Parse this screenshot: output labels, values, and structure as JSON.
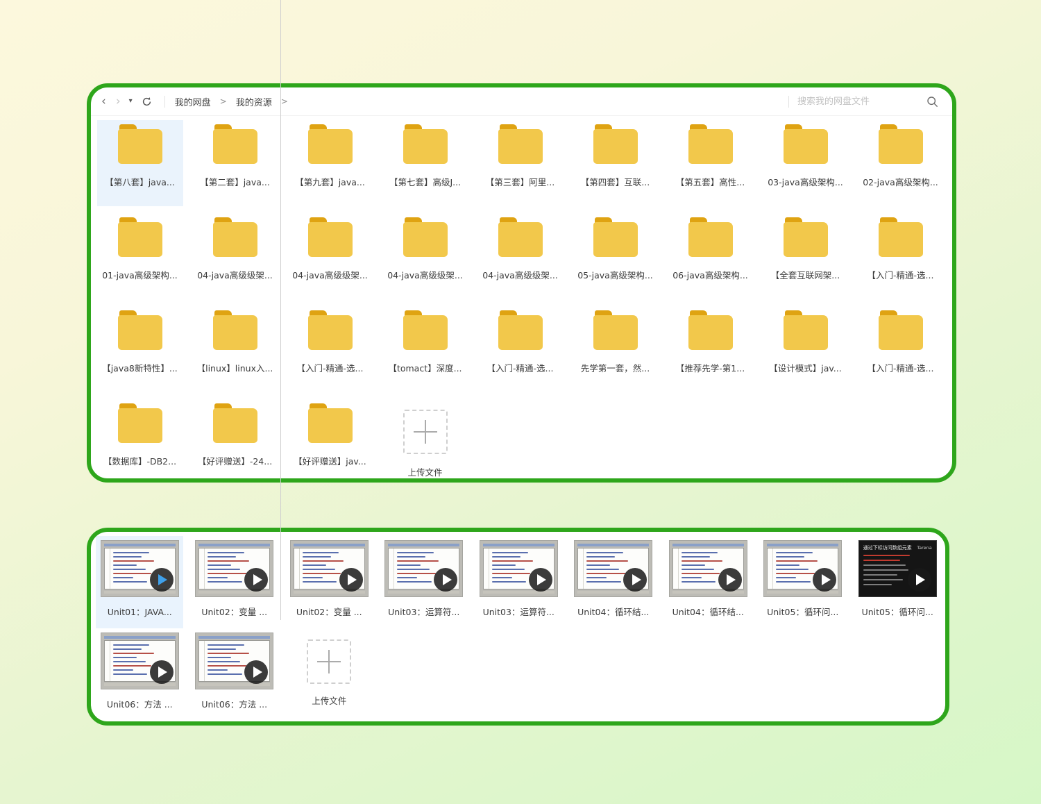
{
  "colors": {
    "panel_border": "#2ea61b",
    "selected_bg": "#eaf3fc",
    "folder_body": "#f2c84b",
    "folder_tab": "#dfa312",
    "background_top": "#fcf8dd",
    "background_bottom": "#d6f7c7",
    "play_blue": "#3fa0ea"
  },
  "toolbar": {
    "back_icon": "‹",
    "forward_icon": "›",
    "dropdown_icon": "▾",
    "breadcrumb": [
      {
        "label": "我的网盘"
      },
      {
        "label": "我的资源"
      }
    ],
    "breadcrumb_separator": ">",
    "search_placeholder": "搜索我的网盘文件"
  },
  "folders": {
    "selected_index": 0,
    "upload_label": "上传文件",
    "items": [
      "【第八套】java...",
      "【第二套】java...",
      "【第九套】java...",
      "【第七套】高级J...",
      "【第三套】阿里...",
      "【第四套】互联...",
      "【第五套】高性...",
      "03-java高级架构...",
      "02-java高级架构...",
      "01-java高级架构...",
      "04-java高级级架...",
      "04-java高级级架...",
      "04-java高级级架...",
      "04-java高级级架...",
      "05-java高级架构...",
      "06-java高级架构...",
      "【全套互联网架...",
      "【入门-精通-选...",
      "【java8新特性】...",
      "【linux】linux入...",
      "【入门-精通-选...",
      "【tomact】深度...",
      "【入门-精通-选...",
      "先学第一套，然...",
      "【推荐先学-第1...",
      "【设计模式】jav...",
      "【入门-精通-选...",
      "【数据库】-DB2...",
      "【好评赠送】-24...",
      "【好评赠送】jav..."
    ]
  },
  "videos": {
    "selected_index": 0,
    "upload_label": "上传文件",
    "items": [
      {
        "label": "Unit01：JAVA...",
        "thumb": "editor"
      },
      {
        "label": "Unit02：变量 ...",
        "thumb": "editor"
      },
      {
        "label": "Unit02：变量 ...",
        "thumb": "editor"
      },
      {
        "label": "Unit03：运算符...",
        "thumb": "editor"
      },
      {
        "label": "Unit03：运算符...",
        "thumb": "editor"
      },
      {
        "label": "Unit04：循环结...",
        "thumb": "editor"
      },
      {
        "label": "Unit04：循环结...",
        "thumb": "editor"
      },
      {
        "label": "Unit05：循环问...",
        "thumb": "editor"
      },
      {
        "label": "Unit05：循环问...",
        "thumb": "slide",
        "slide_title": "通过下标访问数组元素",
        "slide_logo": "Tarena"
      },
      {
        "label": "Unit06：方法 ...",
        "thumb": "editor"
      },
      {
        "label": "Unit06：方法 ...",
        "thumb": "editor"
      }
    ]
  }
}
